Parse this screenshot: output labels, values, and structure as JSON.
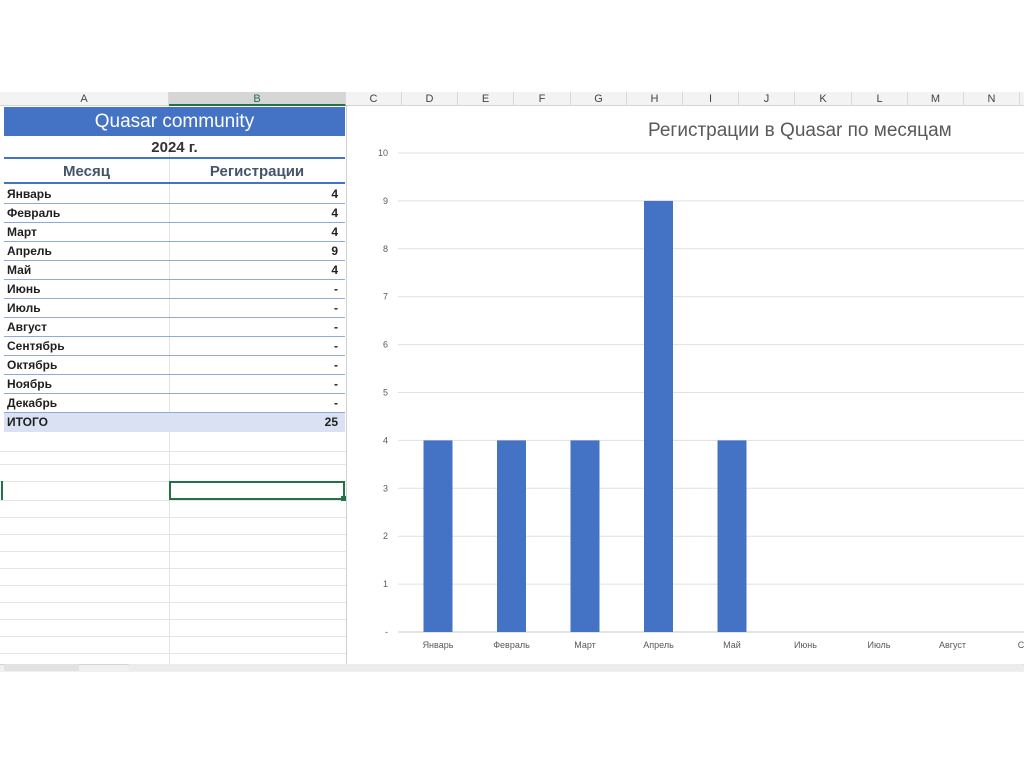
{
  "columns": [
    "A",
    "B",
    "C",
    "D",
    "E",
    "F",
    "G",
    "H",
    "I",
    "J",
    "K",
    "L",
    "M",
    "N"
  ],
  "table": {
    "title": "Quasar community",
    "year": "2024 г.",
    "col_month": "Месяц",
    "col_reg": "Регистрации",
    "rows": [
      {
        "month": "Январь",
        "value": "4"
      },
      {
        "month": "Февраль",
        "value": "4"
      },
      {
        "month": "Март",
        "value": "4"
      },
      {
        "month": "Апрель",
        "value": "9"
      },
      {
        "month": "Май",
        "value": "4"
      },
      {
        "month": "Июнь",
        "value": "-"
      },
      {
        "month": "Июль",
        "value": "-"
      },
      {
        "month": "Август",
        "value": "-"
      },
      {
        "month": "Сентябрь",
        "value": "-"
      },
      {
        "month": "Октябрь",
        "value": "-"
      },
      {
        "month": "Ноябрь",
        "value": "-"
      },
      {
        "month": "Декабрь",
        "value": "-"
      }
    ],
    "total_label": "ИТОГО",
    "total_value": "25"
  },
  "colors": {
    "accent": "#4472c4",
    "selection": "#217346",
    "total_fill": "#d9e1f2"
  },
  "chart_data": {
    "type": "bar",
    "title": "Регистрации в Quasar по месяцам",
    "categories": [
      "Январь",
      "Февраль",
      "Март",
      "Апрель",
      "Май",
      "Июнь",
      "Июль",
      "Август",
      "Сен"
    ],
    "values": [
      4,
      4,
      4,
      9,
      4,
      0,
      0,
      0,
      0
    ],
    "ylim": [
      0,
      10
    ],
    "yticks": [
      "-",
      "1",
      "2",
      "3",
      "4",
      "5",
      "6",
      "7",
      "8",
      "9",
      "10"
    ],
    "grid": true,
    "color": "#4472c4"
  }
}
